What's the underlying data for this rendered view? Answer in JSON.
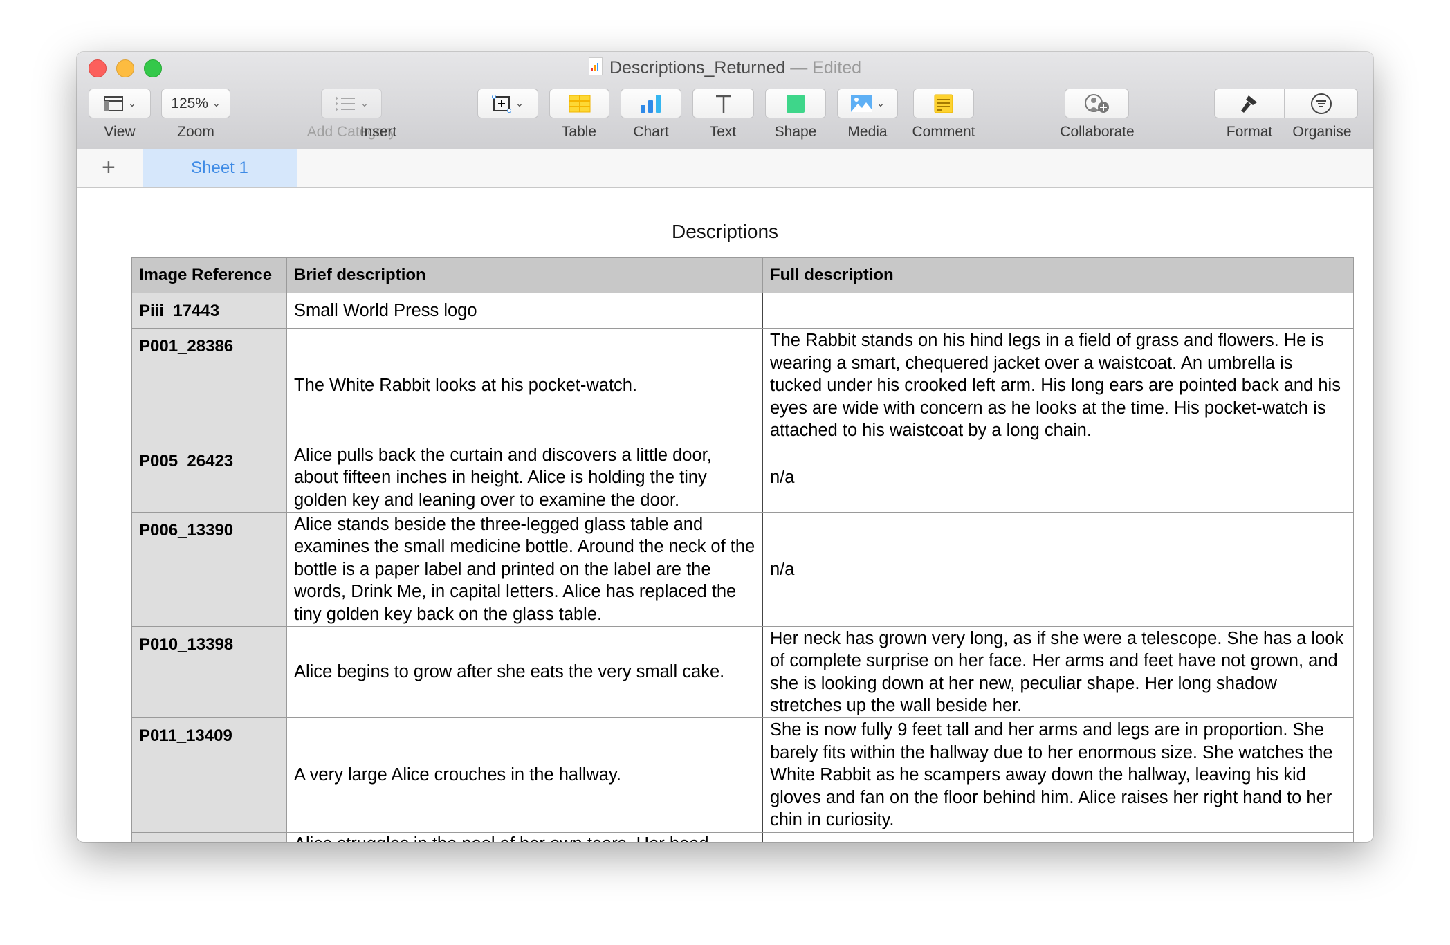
{
  "window": {
    "title": "Descriptions_Returned",
    "status": "— Edited"
  },
  "toolbar": {
    "view": "View",
    "zoom": "Zoom",
    "zoom_value": "125%",
    "add_category": "Add Category",
    "insert": "Insert",
    "table": "Table",
    "chart": "Chart",
    "text": "Text",
    "shape": "Shape",
    "media": "Media",
    "comment": "Comment",
    "collaborate": "Collaborate",
    "format": "Format",
    "organise": "Organise"
  },
  "sheets": {
    "tabs": [
      "Sheet 1"
    ],
    "active": "Sheet 1"
  },
  "document": {
    "title": "Descriptions"
  },
  "table": {
    "headers": [
      "Image Reference",
      "Brief description",
      "Full description"
    ],
    "rows": [
      {
        "ref": "Piii_17443",
        "brief": "Small World Press logo",
        "full": ""
      },
      {
        "ref": "P001_28386",
        "brief": "The White Rabbit looks at his pocket-watch.",
        "full": "The Rabbit stands on his hind legs in a field of grass and flowers. He is wearing a smart, chequered jacket over a waistcoat. An umbrella is tucked under his crooked left arm. His long ears are pointed back and his eyes are wide with concern as he looks at the time. His pocket-watch is attached to his waistcoat by a long chain."
      },
      {
        "ref": "P005_26423",
        "brief": "Alice pulls back the curtain and discovers a little door, about fifteen inches in height. Alice is holding the tiny golden key and leaning over to examine the door.",
        "full": "n/a"
      },
      {
        "ref": "P006_13390",
        "brief": "Alice stands beside the three-legged glass table and examines the small medicine bottle. Around the neck of the bottle is a paper label and printed on the label are the words, Drink Me, in capital letters. Alice has replaced the tiny golden key back on the glass table.",
        "full": "n/a"
      },
      {
        "ref": "P010_13398",
        "brief": "Alice begins to grow after she eats the very small cake.",
        "full": "Her neck has grown very long, as if she were a telescope. She has a look of complete surprise on her face. Her arms and feet have not grown, and she is looking down at her new, peculiar shape. Her long shadow stretches up the wall beside her."
      },
      {
        "ref": "P011_13409",
        "brief": "A very large Alice crouches in the hallway.",
        "full": "She is now fully 9 feet tall and her arms and legs are in proportion. She barely fits within the hallway due to her enormous size. She watches the White Rabbit as he scampers away down the hallway, leaving his kid gloves and fan on the floor behind him. Alice raises her right hand to her chin in curiosity."
      },
      {
        "ref": "",
        "brief": "Alice struggles in the pool of her own tears. Her head",
        "full": ""
      }
    ]
  },
  "colors": {
    "close": "#fc605c",
    "minimize": "#fdbc40",
    "zoom": "#34c84a",
    "accent": "#3d8ae5",
    "sheet_tab_bg": "#d6e7fb",
    "header_bg": "#c8c8c8",
    "ref_col_bg": "#dedede"
  }
}
